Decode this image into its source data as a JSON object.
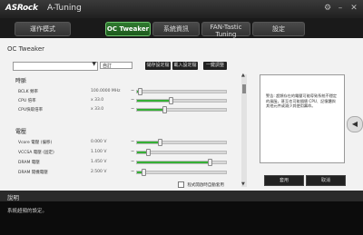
{
  "window": {
    "brand": "ASRock",
    "app_title": "A-Tuning",
    "settings_icon": "gear-icon",
    "minimize_icon": "minimize-icon",
    "close_icon": "close-icon"
  },
  "tabs": [
    {
      "label": "運作模式",
      "label2": ""
    },
    {
      "label": "OC Tweaker",
      "label2": ""
    },
    {
      "label": "系統資訊",
      "label2": ""
    },
    {
      "label": "FAN-Tastic",
      "label2": "Tuning"
    },
    {
      "label": "設定",
      "label2": ""
    }
  ],
  "main": {
    "section_title": "OC Tweaker",
    "profile_value": "",
    "profile_name": "自訂",
    "buttons": [
      "儲存設定檔",
      "載入設定檔",
      "一鍵調整"
    ],
    "groups": [
      {
        "title": "時脈"
      },
      {
        "title": "電壓"
      }
    ],
    "rows": [
      {
        "label": "BCLK 頻率",
        "value": "100.0000 MHz",
        "fill": 0.03
      },
      {
        "label": "CPU 倍率",
        "value": "x 33.0",
        "fill": 0.38
      },
      {
        "label": "CPU快取倍率",
        "value": "x 33.0",
        "fill": 0.31
      },
      {
        "label": "Vcore 電壓 (偏移)",
        "value": "0.000 V",
        "fill": 0.25
      },
      {
        "label": "VCCSA 電壓 (固定)",
        "value": "1.100 V",
        "fill": 0.12
      },
      {
        "label": "DRAM 電壓",
        "value": "1.450 V",
        "fill": 0.82
      },
      {
        "label": "DRAM 開機電壓",
        "value": "2.500 V",
        "fill": 0.07
      }
    ],
    "checkbox_label": "程式開啟時自動套用",
    "help_text": "警告: 超頻存在的電壓可能導致系統不穩定的風險，甚至也可能損壞 CPU、記憶體與其他元件或減少其使用壽命。",
    "apply_button": "套用",
    "cancel_button": "取消"
  },
  "description": {
    "title": "說明",
    "text": "系統超頻的設定。"
  },
  "colors": {
    "accent": "#35b035",
    "active_tab": "#2f7a2f"
  }
}
